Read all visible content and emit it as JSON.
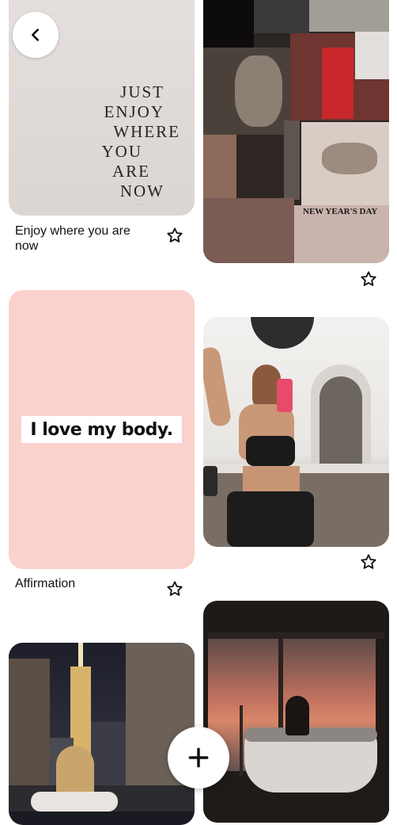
{
  "nav": {
    "back_icon": "chevron-left-icon",
    "add_icon": "plus-icon"
  },
  "pins": [
    {
      "id": "quote",
      "title": "Enjoy where you are now",
      "image_text": [
        "JUST",
        "ENJOY",
        "WHERE",
        "YOU",
        "ARE",
        "NOW"
      ],
      "save_icon": "star-outline-icon"
    },
    {
      "id": "nye",
      "title": "",
      "image_text": "NEW YEAR'S DAY",
      "save_icon": "star-outline-icon"
    },
    {
      "id": "affirmation",
      "title": "Affirmation",
      "image_text": "I love my body.",
      "save_icon": "star-outline-icon"
    },
    {
      "id": "fitness",
      "title": "",
      "save_icon": "star-outline-icon"
    },
    {
      "id": "nyc-night",
      "title": ""
    },
    {
      "id": "bath",
      "title": ""
    }
  ],
  "colors": {
    "star_stroke": "#111111",
    "quote_bg": "#e0dbd7",
    "affirmation_bg": "#fbd1cd",
    "button_bg": "#ffffff"
  }
}
